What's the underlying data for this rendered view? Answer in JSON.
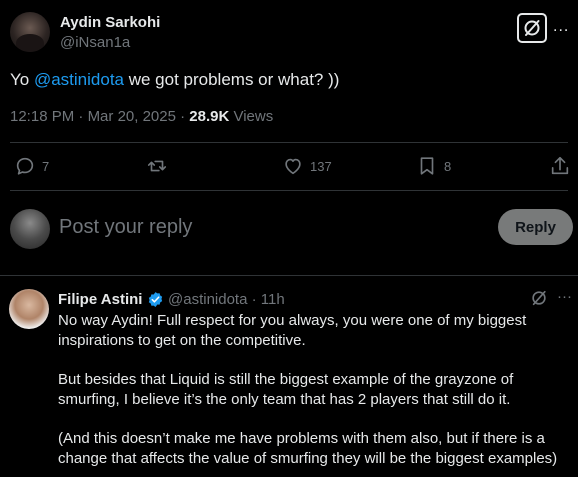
{
  "post": {
    "author_name": "Aydin Sarkohi",
    "author_handle": "@iNsan1a",
    "text_prefix": "Yo ",
    "mention": "@astinidota",
    "text_suffix": " we got problems or what? ))",
    "time": "12:18 PM",
    "separator1": " · ",
    "date": "Mar 20, 2025",
    "separator2": " · ",
    "views_count": "28.9K",
    "views_label": " Views",
    "more_icon": "..."
  },
  "actions": {
    "reply_count": "7",
    "repost_count": "",
    "like_count": "137",
    "bookmark_count": "8"
  },
  "reply_box": {
    "placeholder": "Post your reply",
    "reply_button": "Reply"
  },
  "reply": {
    "author_name": "Filipe Astini",
    "author_handle": "@astinidota · 11h",
    "more_icon": "···",
    "line1": "No way Aydin! Full respect for you always, you were one of my biggest",
    "line2": "inspirations to get on the competitive.",
    "line3": "But besides that Liquid is still the biggest example of the grayzone of",
    "line4": "smurfing, I believe it’s the only team that has 2 players that still do it.",
    "line5": "(And this doesn’t make me have problems with them also, but if there is a",
    "line6": "change that affects the value of smurfing they will be the biggest examples)"
  },
  "colors": {
    "background": "#000000",
    "text": "#e7e9ea",
    "muted": "#71767b",
    "accent": "#1d9bf0",
    "divider": "#2f3336",
    "reply_button_bg": "#787a7a"
  }
}
